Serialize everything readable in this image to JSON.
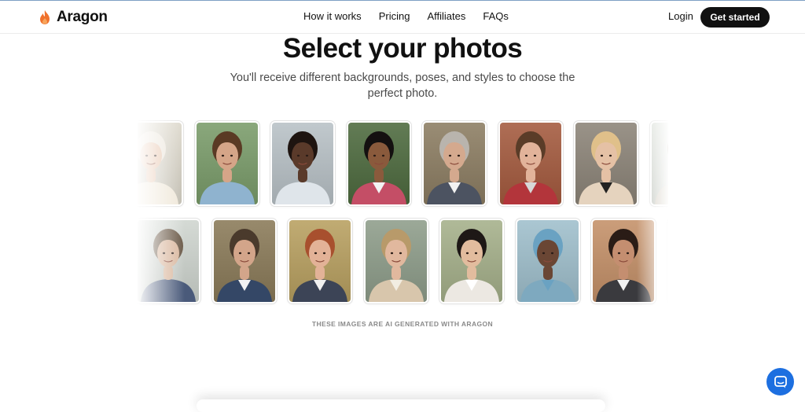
{
  "brand": {
    "name": "Aragon",
    "accent": "#f0712c"
  },
  "nav": {
    "items": [
      "How it works",
      "Pricing",
      "Affiliates",
      "FAQs"
    ]
  },
  "header": {
    "login": "Login",
    "cta": "Get started"
  },
  "hero": {
    "title": "Select your photos",
    "subtitle": "You'll receive different backgrounds, poses, and styles to choose the perfect photo."
  },
  "gallery": {
    "rows": [
      [
        {
          "bg": "#d9d4c6",
          "skin": "#e7c5ad",
          "hair": "#ece6dc",
          "cloth": "#efe7d8",
          "accent": "#efe7d8"
        },
        {
          "bg": "#7a9c6a",
          "skin": "#d5a588",
          "hair": "#5a3a24",
          "cloth": "#8fb3cf",
          "accent": "#8fb3cf"
        },
        {
          "bg": "#b8c1c6",
          "skin": "#5a3a2a",
          "hair": "#1e1410",
          "cloth": "#dfe5ea",
          "accent": "#dfe5ea"
        },
        {
          "bg": "#4d6a3e",
          "skin": "#8a5a3c",
          "hair": "#141010",
          "cloth": "#c44e66",
          "accent": "#f3f3f3"
        },
        {
          "bg": "#8c7d62",
          "skin": "#d4a98e",
          "hair": "#b9b4ad",
          "cloth": "#4c5361",
          "accent": "#f2f2f2"
        },
        {
          "bg": "#a45a3e",
          "skin": "#e2b39a",
          "hair": "#5a3c28",
          "cloth": "#b3353b",
          "accent": "#d7d7d7"
        },
        {
          "bg": "#8c8478",
          "skin": "#e5c1a5",
          "hair": "#e0c08a",
          "cloth": "#e5d3be",
          "accent": "#222222"
        },
        {
          "bg": "#d3d9d0",
          "skin": "#e7c5ad",
          "hair": "#6b4a32",
          "cloth": "#cfc7bb",
          "accent": "#cfc7bb"
        }
      ],
      [
        {
          "bg": "#cfd5cf",
          "skin": "#d9b79e",
          "hair": "#6b5a48",
          "cloth": "#4a5a7a",
          "accent": "#4a5a7a"
        },
        {
          "bg": "#8a7a58",
          "skin": "#d3a58a",
          "hair": "#4a3a2c",
          "cloth": "#344766",
          "accent": "#f2f2f2"
        },
        {
          "bg": "#b8a060",
          "skin": "#e3b297",
          "hair": "#a8502e",
          "cloth": "#3c4456",
          "accent": "#f0f0f0"
        },
        {
          "bg": "#8e9d8a",
          "skin": "#e1b89e",
          "hair": "#b89a6a",
          "cloth": "#d8c6ac",
          "accent": "#f2ede2"
        },
        {
          "bg": "#a5b08a",
          "skin": "#e2bc9e",
          "hair": "#1e1816",
          "cloth": "#ece8e2",
          "accent": "#ffffff"
        },
        {
          "bg": "#9fbfcc",
          "skin": "#6a4634",
          "hair": "#6aa2c2",
          "cloth": "#7ea9bf",
          "accent": "#6aa2c2"
        },
        {
          "bg": "#c49068",
          "skin": "#c48e70",
          "hair": "#2a1c16",
          "cloth": "#3a3a3e",
          "accent": "#f2f2f2"
        },
        {
          "bg": "#c9cfc7",
          "skin": "#d9b79e",
          "hair": "#3a2c22",
          "cloth": "#5a6a8a",
          "accent": "#f2f2f2"
        }
      ]
    ]
  },
  "note": "THESE IMAGES ARE AI GENERATED WITH ARAGON",
  "chat_icon": "chat-bubble-icon"
}
